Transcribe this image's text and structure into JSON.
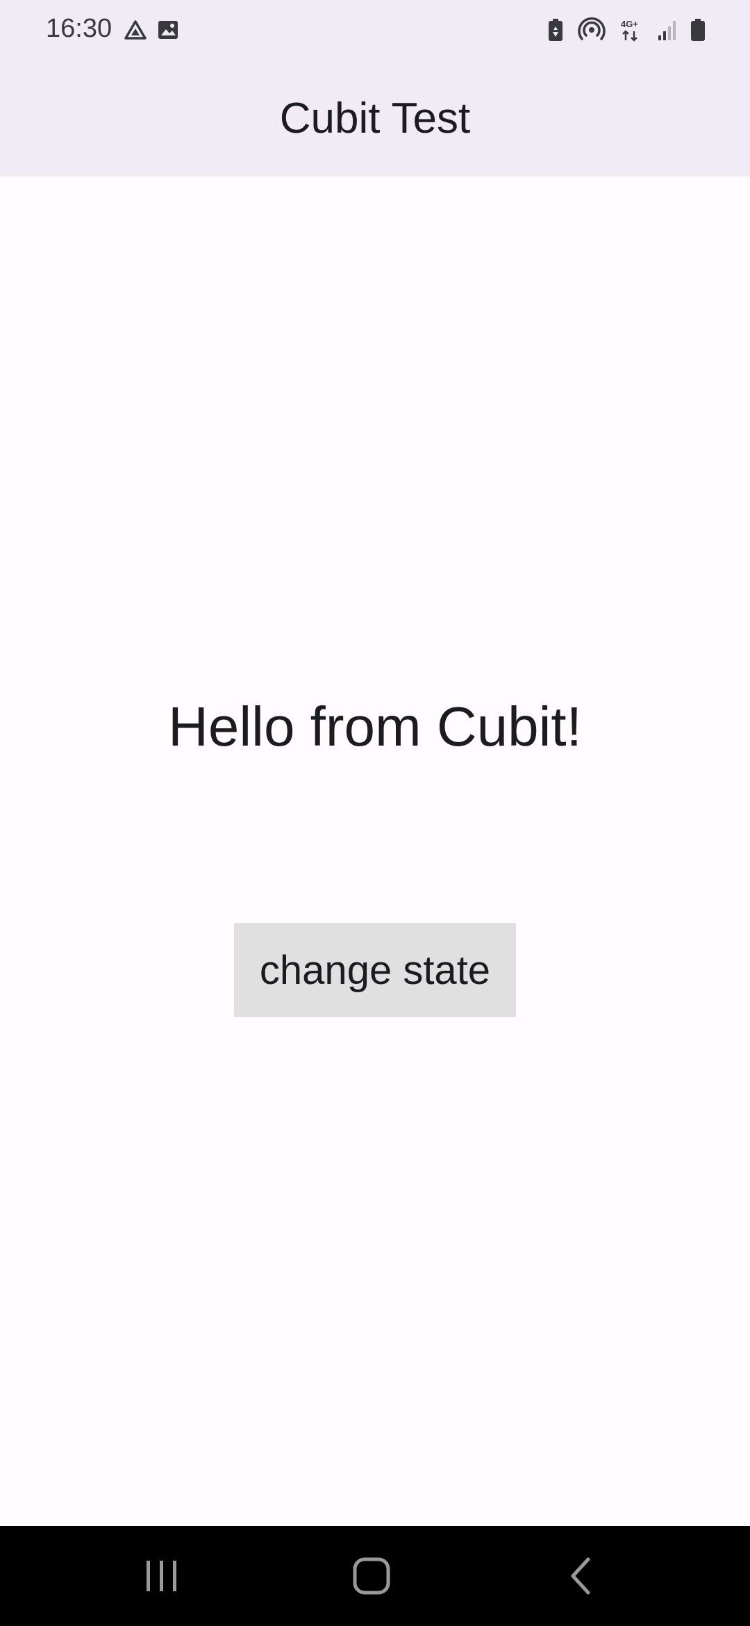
{
  "status_bar": {
    "time": "16:30",
    "left_icons": [
      "drive-icon",
      "image-icon"
    ],
    "right_icons": [
      "battery-saver-icon",
      "hotspot-icon",
      "network-4g-icon",
      "signal-icon",
      "battery-icon"
    ],
    "network_label": "4G+"
  },
  "app_bar": {
    "title": "Cubit Test",
    "background": "#f1ebf6"
  },
  "main": {
    "message": "Hello from Cubit!",
    "button_label": "change state",
    "button_background": "#e0e0e0"
  },
  "nav_bar": {
    "items": [
      "recents-icon",
      "home-icon",
      "back-icon"
    ]
  }
}
